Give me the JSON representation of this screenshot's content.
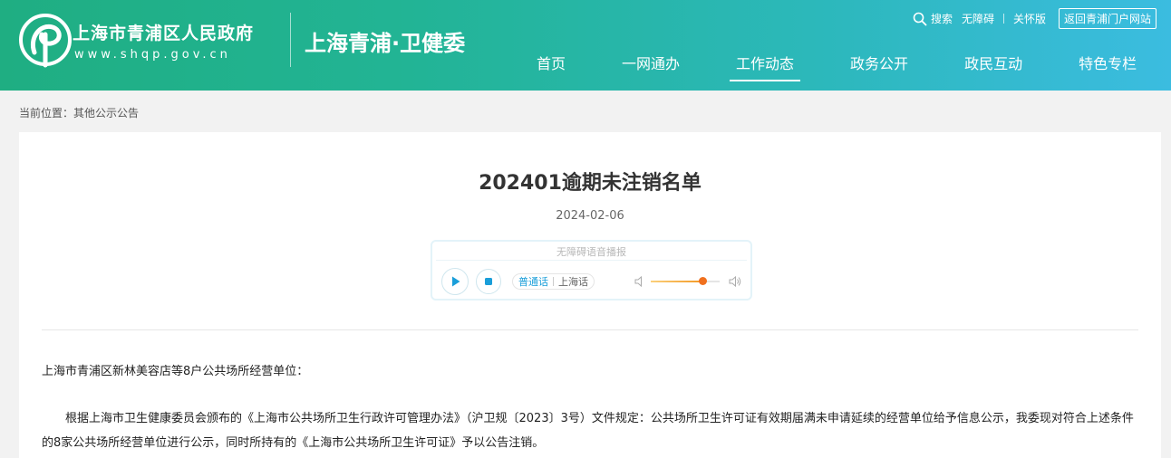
{
  "header": {
    "site_name": "上海市青浦区人民政府",
    "site_url": "www.shqp.gov.cn",
    "dept_name": "上海青浦·卫健委",
    "top_links": {
      "search": "搜索",
      "accessibility": "无障碍",
      "elderly": "关怀版",
      "portal": "返回青浦门户网站"
    },
    "nav": [
      "首页",
      "一网通办",
      "工作动态",
      "政务公开",
      "政民互动",
      "特色专栏"
    ]
  },
  "breadcrumb": "当前位置：其他公示公告",
  "article": {
    "title": "202401逾期未注销名单",
    "date": "2024-02-06",
    "player": {
      "title": "无障碍语音播报",
      "lang_active": "普通话",
      "lang_other": "上海话",
      "volume": 0.75
    },
    "para1": "上海市青浦区新林美容店等8户公共场所经营单位：",
    "para2": "根据上海市卫生健康委员会颁布的《上海市公共场所卫生行政许可管理办法》（沪卫规〔2023〕3号）文件规定：公共场所卫生许可证有效期届满未申请延续的经营单位给予信息公示，我委现对符合上述条件的8家公共场所经营单位进行公示，同时所持有的《上海市公共场所卫生许可证》予以公告注销。"
  },
  "colors": {
    "header_start": "#1fae82",
    "header_end": "#3bbce0",
    "accent": "#1a9ed9",
    "volume": "#f0701e"
  }
}
